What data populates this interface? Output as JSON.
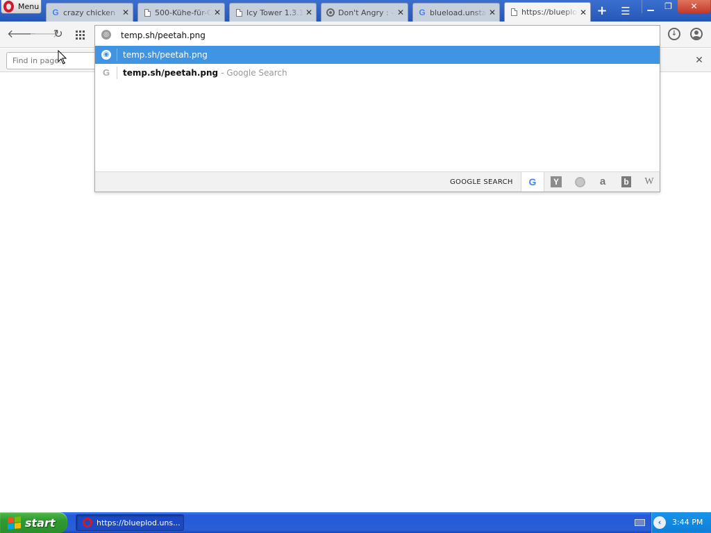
{
  "browser": {
    "menu_label": "Menu",
    "tabs": [
      {
        "title": "crazy chicken",
        "icon": "google-icon"
      },
      {
        "title": "500-Kühe-für-Cl",
        "icon": "document-icon"
      },
      {
        "title": "Icy Tower 1.3.1",
        "icon": "document-icon"
      },
      {
        "title": "Don't Angry : -",
        "icon": "ring-icon"
      },
      {
        "title": "blueload.unsta",
        "icon": "google-icon"
      },
      {
        "title": "https://blueploa",
        "icon": "document-icon",
        "active": true
      }
    ]
  },
  "address_bar": {
    "value": "temp.sh/peetah.png"
  },
  "find_bar": {
    "placeholder": "Find in page..."
  },
  "suggestions": [
    {
      "text": "temp.sh/peetah.png",
      "sub": "",
      "selected": true
    },
    {
      "text": "temp.sh/peetah.png",
      "sub": "- Google Search",
      "selected": false
    }
  ],
  "search_engines": {
    "label": "GOOGLE SEARCH",
    "engines": [
      "google",
      "yahoo",
      "duckduckgo",
      "amazon",
      "bing",
      "wikipedia"
    ],
    "selected": "google"
  },
  "taskbar": {
    "start_label": "start",
    "task_label": "https://blueplod.uns...",
    "clock": "3:44 PM"
  },
  "colors": {
    "accent_selected": "#3f95e3",
    "titlebar": "#2657b8",
    "taskbar": "#2459d8",
    "start_green": "#2f9a2f"
  }
}
